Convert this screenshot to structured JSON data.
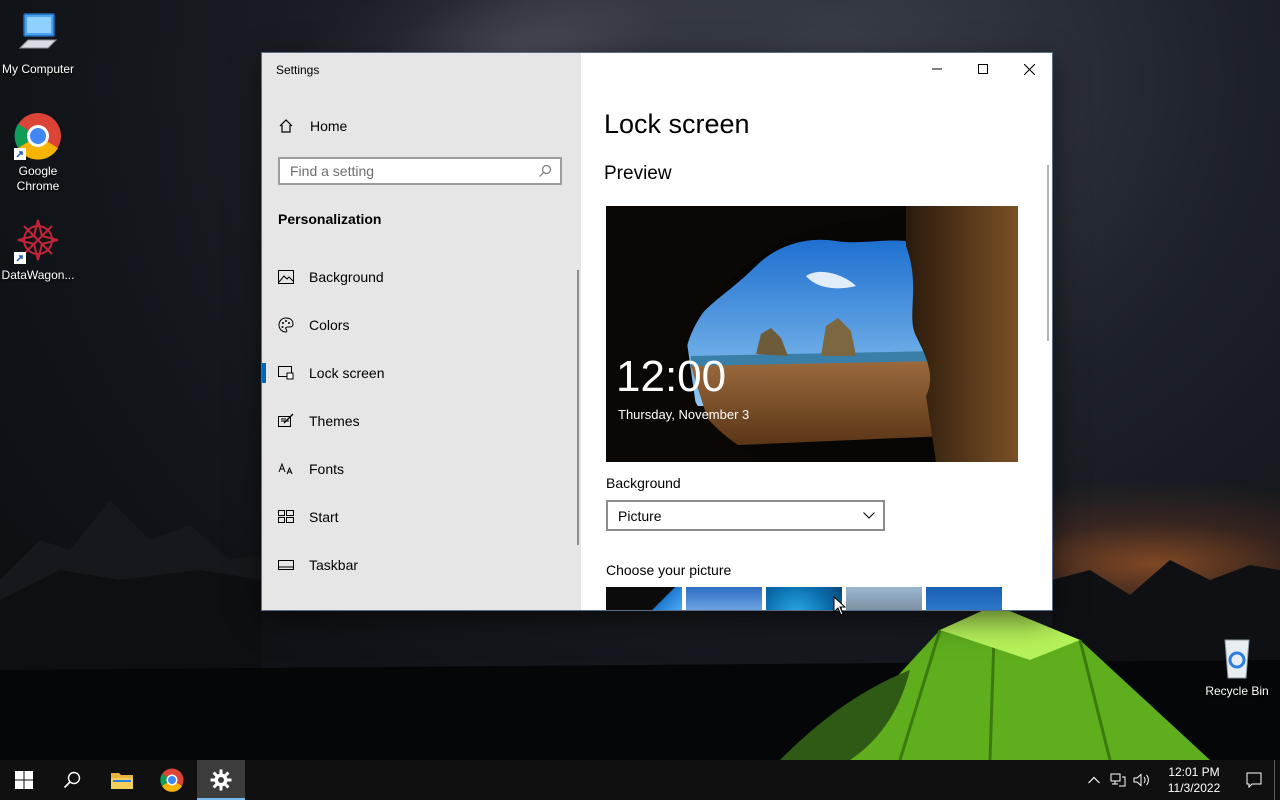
{
  "desktop": {
    "icons": [
      {
        "label": "My Computer"
      },
      {
        "label": "Google Chrome"
      },
      {
        "label": "DataWagon..."
      },
      {
        "label": "Recycle Bin"
      }
    ]
  },
  "window": {
    "title": "Settings",
    "sidebar": {
      "home_label": "Home",
      "search_placeholder": "Find a setting",
      "section": "Personalization",
      "items": [
        {
          "label": "Background",
          "icon": "picture-icon"
        },
        {
          "label": "Colors",
          "icon": "palette-icon"
        },
        {
          "label": "Lock screen",
          "icon": "lock-screen-icon",
          "active": true
        },
        {
          "label": "Themes",
          "icon": "themes-icon"
        },
        {
          "label": "Fonts",
          "icon": "fonts-icon"
        },
        {
          "label": "Start",
          "icon": "start-icon"
        },
        {
          "label": "Taskbar",
          "icon": "taskbar-icon"
        }
      ]
    },
    "main": {
      "title": "Lock screen",
      "preview_heading": "Preview",
      "preview_time": "12:00",
      "preview_date": "Thursday, November 3",
      "background_label": "Background",
      "background_value": "Picture",
      "choose_label": "Choose your picture"
    }
  },
  "taskbar": {
    "time": "12:01 PM",
    "date": "11/3/2022"
  },
  "colors": {
    "accent": "#0067c0",
    "sidebar_bg": "#e6e6e6",
    "taskbar_bg": "#101010"
  }
}
